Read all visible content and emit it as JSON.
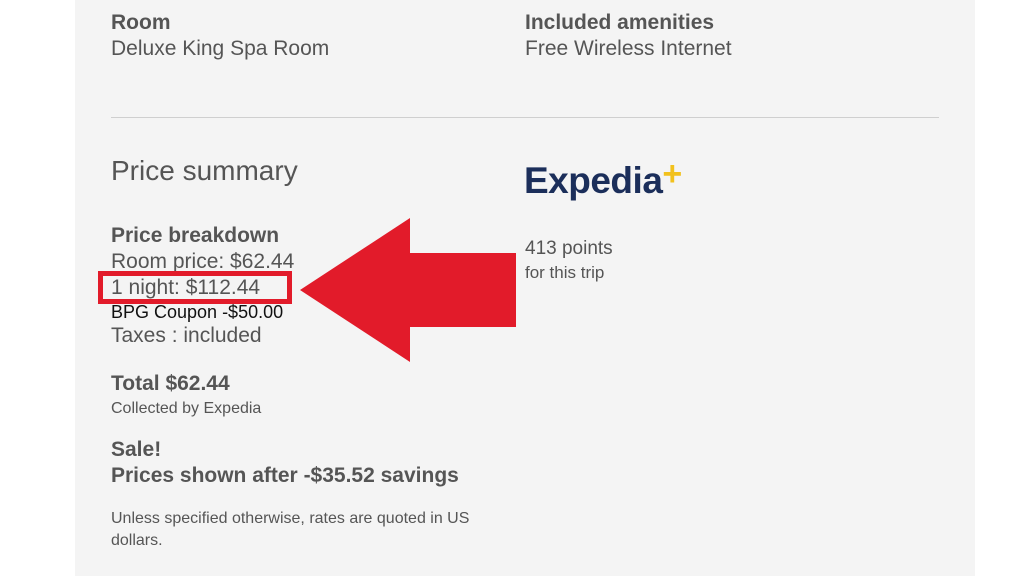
{
  "room": {
    "label": "Room",
    "value": "Deluxe King Spa Room"
  },
  "amenities": {
    "label": "Included amenities",
    "value": "Free Wireless Internet"
  },
  "price_summary": {
    "title": "Price summary",
    "breakdown_label": "Price breakdown",
    "room_price": "Room price: $62.44",
    "one_night": "1 night: $112.44",
    "coupon": "BPG Coupon -$50.00",
    "taxes": "Taxes : included",
    "total": "Total $62.44",
    "collected_by": "Collected by Expedia",
    "sale_label": "Sale!",
    "savings": "Prices shown after -$35.52 savings",
    "currency_note": "Unless specified otherwise, rates are quoted in US dollars."
  },
  "rewards": {
    "logo_text": "Expedia",
    "logo_plus": "+",
    "points": "413 points",
    "points_caption": "for this trip"
  },
  "colors": {
    "panel_bg": "#f4f4f4",
    "text": "#555555",
    "annotation_red": "#e21b2a",
    "logo_navy": "#1b2e5a",
    "logo_yellow": "#f2c11c"
  }
}
